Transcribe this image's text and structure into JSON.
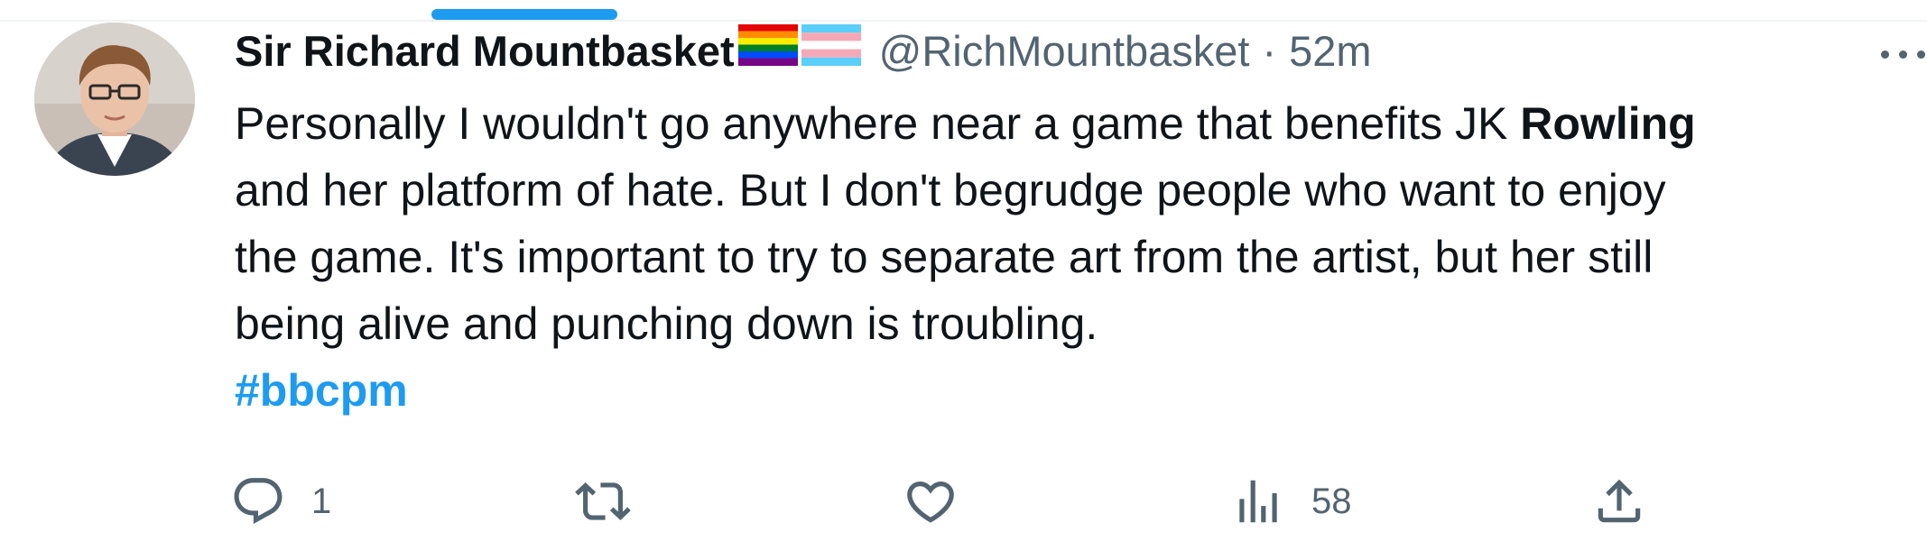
{
  "author": {
    "display_name": "Sir Richard Mountbasket",
    "handle": "@RichMountbasket",
    "separator": "·",
    "timestamp": "52m",
    "badges": [
      "rainbow-flag-emoji",
      "transgender-flag-emoji"
    ]
  },
  "tweet": {
    "lines": [
      {
        "pre": "Personally I wouldn't go anywhere near a game that benefits JK ",
        "bold": "Rowling"
      },
      {
        "text": "and her platform of hate. But I don't begrudge people who want to enjoy"
      },
      {
        "text": "the game. It's important to try to separate art from the artist, but her still"
      },
      {
        "text": "being alive and punching down is troubling."
      }
    ],
    "hashtag": "#bbcpm"
  },
  "actions": {
    "reply_count": "1",
    "retweet_count": "",
    "like_count": "",
    "views_count": "58"
  },
  "icons": {
    "reply": "reply-icon",
    "retweet": "retweet-icon",
    "like": "heart-icon",
    "views": "views-chart-icon",
    "share": "share-icon",
    "more": "more-dots-icon"
  },
  "colors": {
    "accent": "#1d9bf0",
    "text": "#0f1419",
    "secondary": "#536471",
    "divider": "#eff3f4"
  }
}
